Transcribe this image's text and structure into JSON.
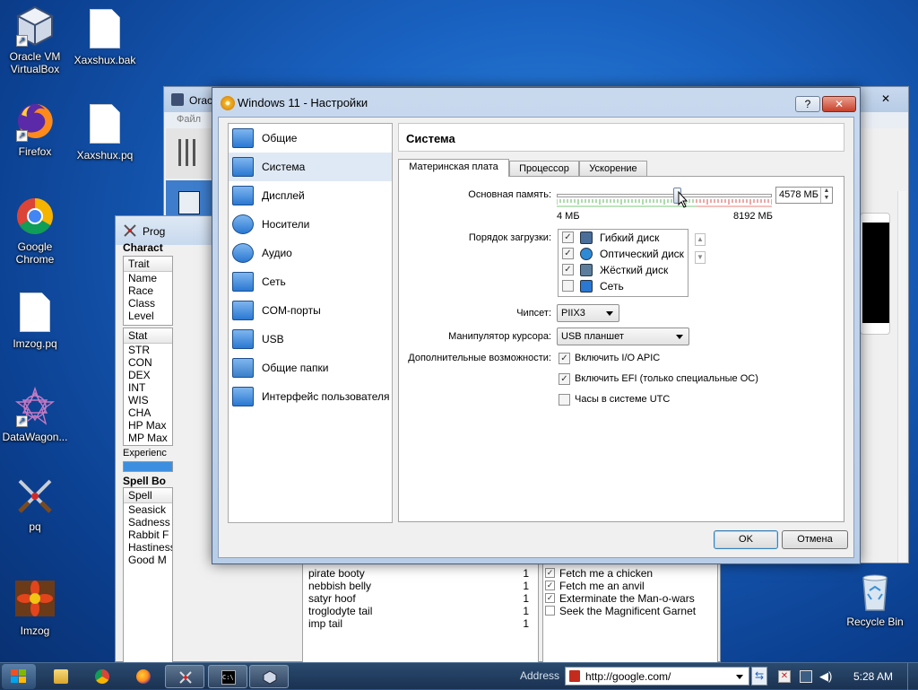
{
  "desktop": {
    "icons": [
      {
        "label": "Oracle VM VirtualBox",
        "icon": "virtualbox-icon"
      },
      {
        "label": "Xaxshux.bak",
        "icon": "document-icon"
      },
      {
        "label": "Firefox",
        "icon": "firefox-icon"
      },
      {
        "label": "Xaxshux.pq",
        "icon": "document-icon"
      },
      {
        "label": "Google Chrome",
        "icon": "chrome-icon"
      },
      {
        "label": "Imzog.pq",
        "icon": "document-icon"
      },
      {
        "label": "DataWagon...",
        "icon": "datawagon-icon"
      },
      {
        "label": "pq",
        "icon": "crossed-swords-icon"
      },
      {
        "label": "Imzog",
        "icon": "imzog-flower-icon"
      },
      {
        "label": "Recycle Bin",
        "icon": "recycle-bin-icon"
      }
    ]
  },
  "vbox_manager": {
    "title": "Orac",
    "menu_file": "Файл"
  },
  "progress_quest": {
    "title": "Prog",
    "character_header": "Charact",
    "traits_header": "Trait",
    "traits": [
      "Name",
      "Race",
      "Class",
      "Level"
    ],
    "stats_header": "Stat",
    "stats": [
      "STR",
      "CON",
      "DEX",
      "INT",
      "WIS",
      "CHA",
      "HP Max",
      "MP Max"
    ],
    "experience_label": "Experienc",
    "spellbook_header": "Spell Bo",
    "spell_col": "Spell",
    "spells": [
      "Seasick",
      "Sadness",
      "Rabbit F",
      "Hastiness",
      "Good M"
    ],
    "inventory": [
      {
        "name": "pirate booty",
        "qty": "1"
      },
      {
        "name": "nebbish belly",
        "qty": "1"
      },
      {
        "name": "satyr hoof",
        "qty": "1"
      },
      {
        "name": "troglodyte tail",
        "qty": "1"
      },
      {
        "name": "imp tail",
        "qty": "1"
      }
    ],
    "quests": [
      {
        "label": "Fetch me a chicken",
        "done": "✓"
      },
      {
        "label": "Fetch me an anvil",
        "done": "✓"
      },
      {
        "label": "Exterminate the Man-o-wars",
        "done": "✓"
      },
      {
        "label": "Seek the Magnificent Garnet",
        "done": ""
      }
    ]
  },
  "dialog": {
    "title": "Windows 11 - Настройки",
    "help_btn": "?",
    "close_btn": "✕",
    "nav": [
      {
        "label": "Общие"
      },
      {
        "label": "Система"
      },
      {
        "label": "Дисплей"
      },
      {
        "label": "Носители"
      },
      {
        "label": "Аудио"
      },
      {
        "label": "Сеть"
      },
      {
        "label": "COM-порты"
      },
      {
        "label": "USB"
      },
      {
        "label": "Общие папки"
      },
      {
        "label": "Интерфейс пользователя"
      }
    ],
    "section_title": "Система",
    "tabs": [
      "Материнская плата",
      "Процессор",
      "Ускорение"
    ],
    "memory": {
      "label": "Основная память:",
      "value": "4578 МБ",
      "min_label": "4 МБ",
      "max_label": "8192 МБ",
      "min": 4,
      "max": 8192,
      "current": 4578
    },
    "boot": {
      "label": "Порядок загрузки:",
      "items": [
        {
          "label": "Гибкий диск",
          "checked": "✓",
          "icon": "floppy-icon"
        },
        {
          "label": "Оптический диск",
          "checked": "✓",
          "icon": "optical-disc-icon"
        },
        {
          "label": "Жёсткий диск",
          "checked": "✓",
          "icon": "hard-disk-icon"
        },
        {
          "label": "Сеть",
          "checked": "",
          "icon": "network-icon"
        }
      ]
    },
    "chipset": {
      "label": "Чипсет:",
      "value": "PIIX3"
    },
    "pointer": {
      "label": "Манипулятор курсора:",
      "value": "USB планшет"
    },
    "features": {
      "label": "Дополнительные возможности:",
      "items": [
        {
          "label": "Включить I/O APIC",
          "checked": "✓"
        },
        {
          "label": "Включить EFI (только специальные ОС)",
          "checked": "✓"
        },
        {
          "label": "Часы в системе UTC",
          "checked": ""
        }
      ]
    },
    "ok": "OK",
    "cancel": "Отмена"
  },
  "taskbar": {
    "address_label": "Address",
    "address_value": "http://google.com/",
    "clock": "5:28 AM"
  }
}
